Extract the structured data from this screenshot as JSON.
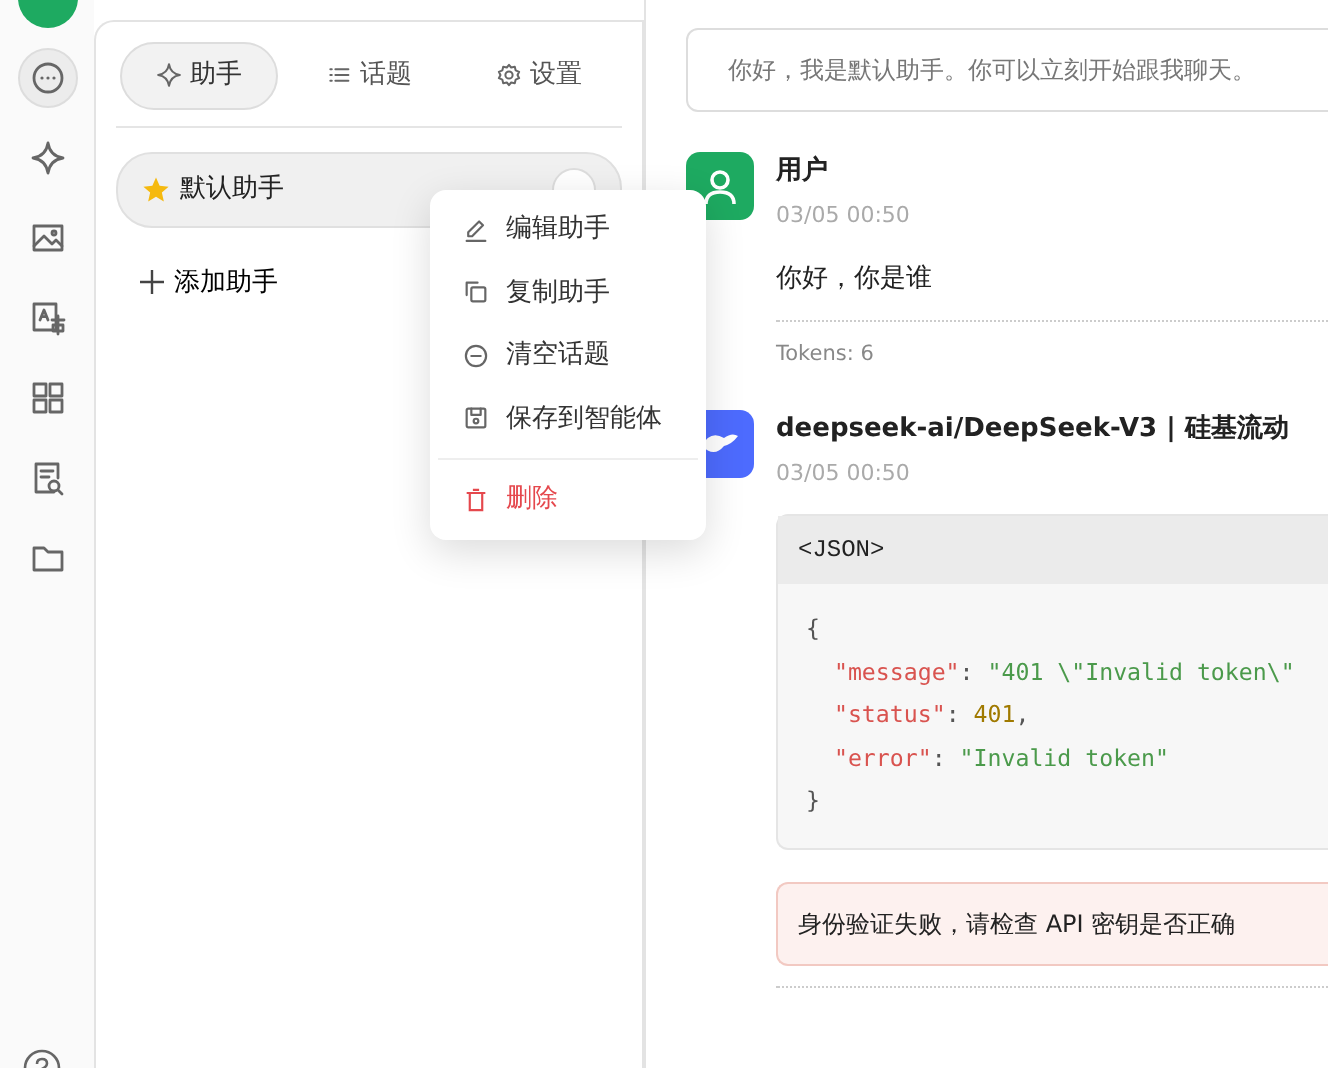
{
  "rail": {
    "items": [
      {
        "kind": "chat",
        "selected": true
      },
      {
        "kind": "sparkle",
        "selected": false
      },
      {
        "kind": "image",
        "selected": false
      },
      {
        "kind": "translate",
        "selected": false
      },
      {
        "kind": "grid",
        "selected": false
      },
      {
        "kind": "docsearch",
        "selected": false
      },
      {
        "kind": "folder",
        "selected": false
      }
    ]
  },
  "tabs": [
    {
      "label": "助手",
      "kind": "sparkle",
      "selected": true
    },
    {
      "label": "话题",
      "kind": "list",
      "selected": false
    },
    {
      "label": "设置",
      "kind": "gear",
      "selected": false
    }
  ],
  "assistants": [
    {
      "name": "默认助手",
      "selected": true
    }
  ],
  "add_assistant": "添加助手",
  "context_menu": [
    {
      "label": "编辑助手",
      "kind": "pencil",
      "danger": false
    },
    {
      "label": "复制助手",
      "kind": "copy",
      "danger": false
    },
    {
      "label": "清空话题",
      "kind": "minus",
      "danger": false
    },
    {
      "label": "保存到智能体",
      "kind": "save",
      "danger": false
    },
    {
      "label": "删除",
      "kind": "trash",
      "danger": true
    }
  ],
  "prompt": "你好，我是默认助手。你可以立刻开始跟我聊天。",
  "messages": [
    {
      "kind": "user",
      "name": "用户",
      "time": "03/05 00:50",
      "text": "你好，你是谁",
      "tokens": "Tokens: 6"
    },
    {
      "kind": "model",
      "name": "deepseek-ai/DeepSeek-V3 | 硅基流动",
      "time": "03/05 00:50",
      "code_lang": "<JSON>",
      "code_lines": [
        [
          {
            "kind": "punct",
            "s": "{"
          }
        ],
        [
          {
            "kind": "key",
            "s": "  \"message\""
          },
          {
            "kind": "punct",
            "s": ": "
          },
          {
            "kind": "string",
            "s": "\"401 \\\"Invalid token\\\""
          }
        ],
        [
          {
            "kind": "key",
            "s": "  \"status\""
          },
          {
            "kind": "punct",
            "s": ": "
          },
          {
            "kind": "number",
            "s": "401"
          },
          {
            "kind": "punct",
            "s": ","
          }
        ],
        [
          {
            "kind": "key",
            "s": "  \"error\""
          },
          {
            "kind": "punct",
            "s": ": "
          },
          {
            "kind": "string",
            "s": "\"Invalid token\""
          }
        ],
        [
          {
            "kind": "punct",
            "s": "}"
          }
        ]
      ],
      "error": "身份验证失败，请检查 API 密钥是否正确"
    }
  ]
}
